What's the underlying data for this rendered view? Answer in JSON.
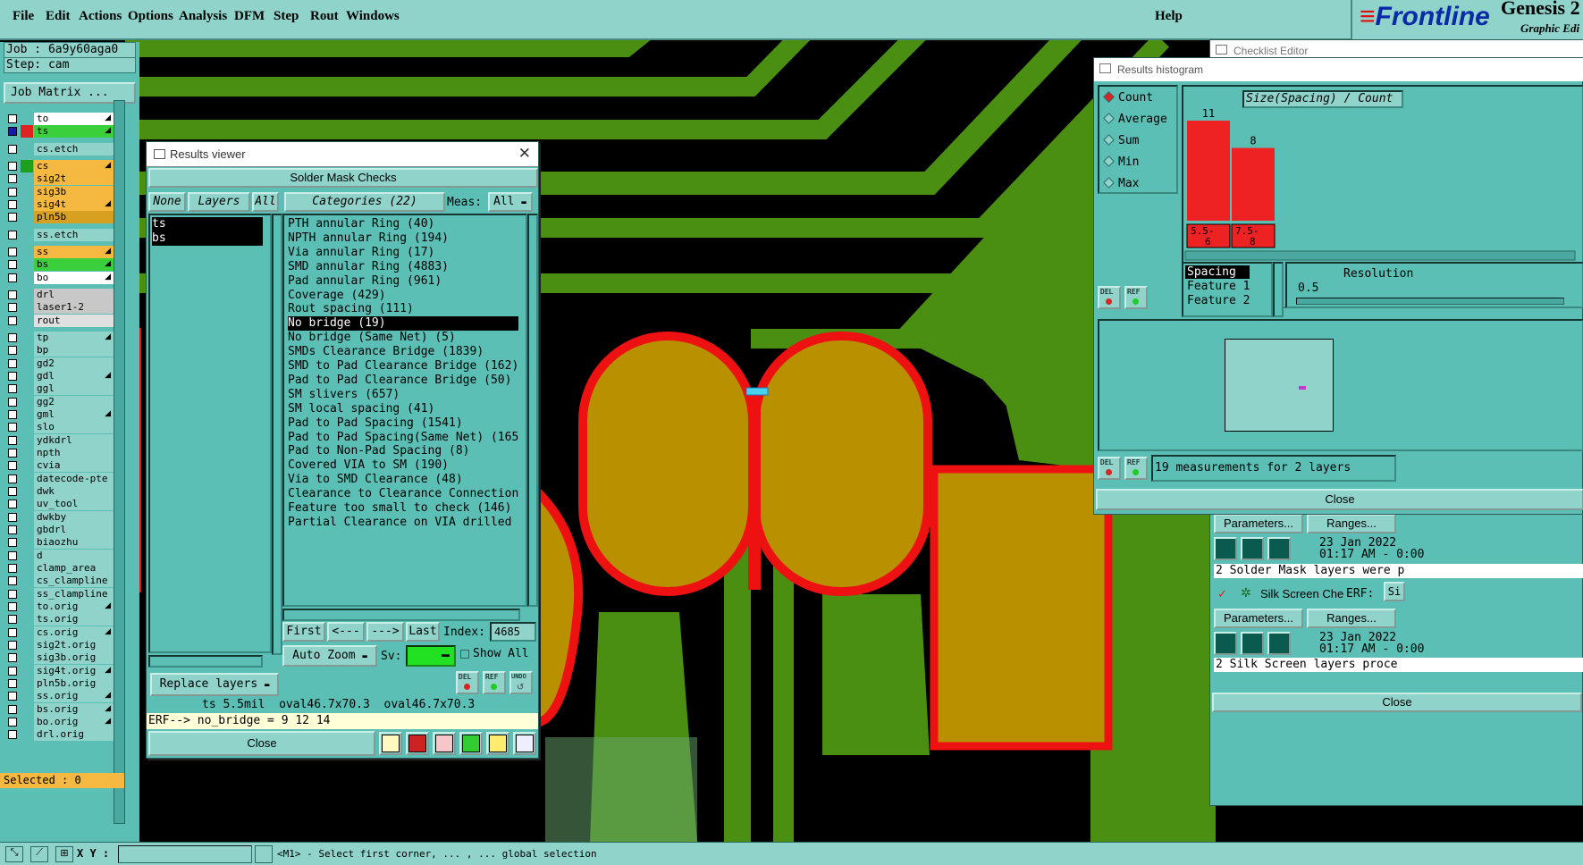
{
  "menu": [
    "File",
    "Edit",
    "Actions",
    "Options",
    "Analysis",
    "DFM",
    "Step",
    "Rout",
    "Windows"
  ],
  "help": "Help",
  "brand": {
    "name": "Frontline",
    "product": "Genesis 2",
    "subtitle": "Graphic Edi"
  },
  "job": {
    "job_line": "Job : 6a9y60aga0",
    "step_line": "Step: cam",
    "matrix_button": "Job Matrix ..."
  },
  "layers": [
    {
      "name": "to",
      "color": "#ffffff",
      "checked": false,
      "arrow": true
    },
    {
      "name": "ts",
      "color": "#3bcf3b",
      "checked": true,
      "swatch": "#d22",
      "arrow": true
    },
    {
      "name": "cs.etch",
      "color": "#8fd3cb",
      "checked": false,
      "gap": true
    },
    {
      "name": "cs",
      "color": "#f5b840",
      "checked": false,
      "swatch": "#1ea01e",
      "arrow": true,
      "gap": true
    },
    {
      "name": "sig2t",
      "color": "#f5b840",
      "checked": false
    },
    {
      "name": "sig3b",
      "color": "#f5b840",
      "checked": false
    },
    {
      "name": "sig4t",
      "color": "#f5b840",
      "checked": false,
      "arrow": true
    },
    {
      "name": "pln5b",
      "color": "#d8a020",
      "checked": false
    },
    {
      "name": "ss.etch",
      "color": "#8fd3cb",
      "checked": false,
      "gap": true
    },
    {
      "name": "ss",
      "color": "#f5b840",
      "checked": false,
      "arrow": true,
      "gap": true
    },
    {
      "name": "bs",
      "color": "#3bcf3b",
      "checked": false,
      "arrow": true
    },
    {
      "name": "bo",
      "color": "#ffffff",
      "checked": false,
      "arrow": true
    },
    {
      "name": "drl",
      "color": "#c8c8c8",
      "checked": false,
      "gap": true
    },
    {
      "name": "laser1-2",
      "color": "#c8c8c8",
      "checked": false
    },
    {
      "name": "rout",
      "color": "#e0e0e0",
      "checked": false
    },
    {
      "name": "tp",
      "color": "#8fd3cb",
      "checked": false,
      "arrow": true,
      "gap": true
    },
    {
      "name": "bp",
      "color": "#8fd3cb",
      "checked": false
    },
    {
      "name": "gd2",
      "color": "#8fd3cb",
      "checked": false
    },
    {
      "name": "gdl",
      "color": "#8fd3cb",
      "checked": false,
      "arrow": true
    },
    {
      "name": "ggl",
      "color": "#8fd3cb",
      "checked": false
    },
    {
      "name": "gg2",
      "color": "#8fd3cb",
      "checked": false
    },
    {
      "name": "gml",
      "color": "#8fd3cb",
      "checked": false,
      "arrow": true
    },
    {
      "name": "slo",
      "color": "#8fd3cb",
      "checked": false
    },
    {
      "name": "ydkdrl",
      "color": "#8fd3cb",
      "checked": false
    },
    {
      "name": "npth",
      "color": "#8fd3cb",
      "checked": false
    },
    {
      "name": "cvia",
      "color": "#8fd3cb",
      "checked": false
    },
    {
      "name": "datecode-pte",
      "color": "#8fd3cb",
      "checked": false
    },
    {
      "name": "dwk",
      "color": "#8fd3cb",
      "checked": false
    },
    {
      "name": "uv_tool",
      "color": "#8fd3cb",
      "checked": false
    },
    {
      "name": "dwkby",
      "color": "#8fd3cb",
      "checked": false
    },
    {
      "name": "gbdrl",
      "color": "#8fd3cb",
      "checked": false
    },
    {
      "name": "biaozhu",
      "color": "#8fd3cb",
      "checked": false
    },
    {
      "name": "d",
      "color": "#8fd3cb",
      "checked": false
    },
    {
      "name": "clamp_area",
      "color": "#8fd3cb",
      "checked": false
    },
    {
      "name": "cs_clampline",
      "color": "#8fd3cb",
      "checked": false
    },
    {
      "name": "ss_clampline",
      "color": "#8fd3cb",
      "checked": false
    },
    {
      "name": "to.orig",
      "color": "#8fd3cb",
      "checked": false,
      "arrow": true
    },
    {
      "name": "ts.orig",
      "color": "#8fd3cb",
      "checked": false
    },
    {
      "name": "cs.orig",
      "color": "#8fd3cb",
      "checked": false,
      "arrow": true
    },
    {
      "name": "sig2t.orig",
      "color": "#8fd3cb",
      "checked": false
    },
    {
      "name": "sig3b.orig",
      "color": "#8fd3cb",
      "checked": false
    },
    {
      "name": "sig4t.orig",
      "color": "#8fd3cb",
      "checked": false,
      "arrow": true
    },
    {
      "name": "pln5b.orig",
      "color": "#8fd3cb",
      "checked": false
    },
    {
      "name": "ss.orig",
      "color": "#8fd3cb",
      "checked": false,
      "arrow": true
    },
    {
      "name": "bs.orig",
      "color": "#8fd3cb",
      "checked": false,
      "arrow": true
    },
    {
      "name": "bo.orig",
      "color": "#8fd3cb",
      "checked": false,
      "arrow": true
    },
    {
      "name": "drl.orig",
      "color": "#8fd3cb",
      "checked": false
    }
  ],
  "selected_label": "Selected : 0",
  "results_viewer": {
    "title": "Results viewer",
    "header": "Solder Mask Checks",
    "none_btn": "None",
    "layers_btn": "Layers",
    "all_btn": "All",
    "categories_btn": "Categories (22)",
    "meas_label": "Meas:",
    "meas_value": "All",
    "layers": [
      "ts",
      "bs"
    ],
    "categories": [
      "PTH annular Ring (40)",
      "NPTH annular Ring (194)",
      "Via annular Ring (17)",
      "SMD annular Ring (4883)",
      "Pad annular Ring (961)",
      "Coverage (429)",
      "Rout spacing (111)",
      "No bridge (19)",
      "No bridge (Same Net) (5)",
      "SMDs Clearance Bridge (1839)",
      "SMD to Pad Clearance Bridge (162)",
      "Pad to Pad Clearance Bridge (50)",
      "SM slivers (657)",
      "SM local spacing (41)",
      "Pad to Pad Spacing (1541)",
      "Pad to Pad Spacing(Same Net) (165",
      "Pad to Non-Pad Spacing (8)",
      "Covered VIA to SM (190)",
      "Via to SMD Clearance (48)",
      "Clearance to Clearance Connection",
      "Feature too small to check (146)",
      "Partial Clearance on VIA drilled"
    ],
    "selected_category_index": 7,
    "first_btn": "First",
    "prev_btn": "<---",
    "next_btn": "--->",
    "last_btn": "Last",
    "index_label": "Index:",
    "index_value": "4685",
    "auto_zoom": "Auto Zoom",
    "sv_label": "Sv:",
    "show_all": "Show All",
    "replace_layers": "Replace layers",
    "del": "DEL",
    "ref": "REF",
    "undo": "UNDO",
    "info_line": "ts 5.5mil  oval46.7x70.3  oval46.7x70.3",
    "erf_line": "ERF--> no_bridge = 9 12 14",
    "close": "Close"
  },
  "histogram": {
    "title": "Results histogram",
    "modes": [
      "Count",
      "Average",
      "Sum",
      "Min",
      "Max"
    ],
    "active_mode": "Count",
    "chart_title": "Size(Spacing) / Count",
    "spacing_label": "Spacing",
    "feature1": "Feature 1",
    "feature2": "Feature 2",
    "resolution_label": "Resolution",
    "resolution_value": "0.5",
    "measurements": "19 measurements for 2 layers",
    "close": "Close",
    "del": "DEL",
    "ref": "REF"
  },
  "chart_data": {
    "type": "bar",
    "categories": [
      "5.5-6",
      "7.5-8"
    ],
    "values": [
      11,
      8
    ],
    "title": "Size(Spacing) / Count",
    "xlabel": "Spacing",
    "ylabel": "Count",
    "bar_color": "#ee2222"
  },
  "checklist": {
    "title": "Checklist Editor",
    "parameters_btn": "Parameters...",
    "ranges_btn": "Ranges...",
    "date1": "23 Jan 2022",
    "time1": "01:17 AM - 0:00",
    "status1": "2 Solder Mask layers were p",
    "silk_label": "Silk Screen Che",
    "erf_label": "ERF:",
    "erf_value": "Si",
    "date2": "23 Jan 2022",
    "time2": "01:17 AM - 0:00",
    "status2": "2 Silk Screen layers proce",
    "close": "Close"
  },
  "status": {
    "xy_label": "X Y :",
    "message": "<M1> - Select first corner, ... , ... global selection"
  }
}
